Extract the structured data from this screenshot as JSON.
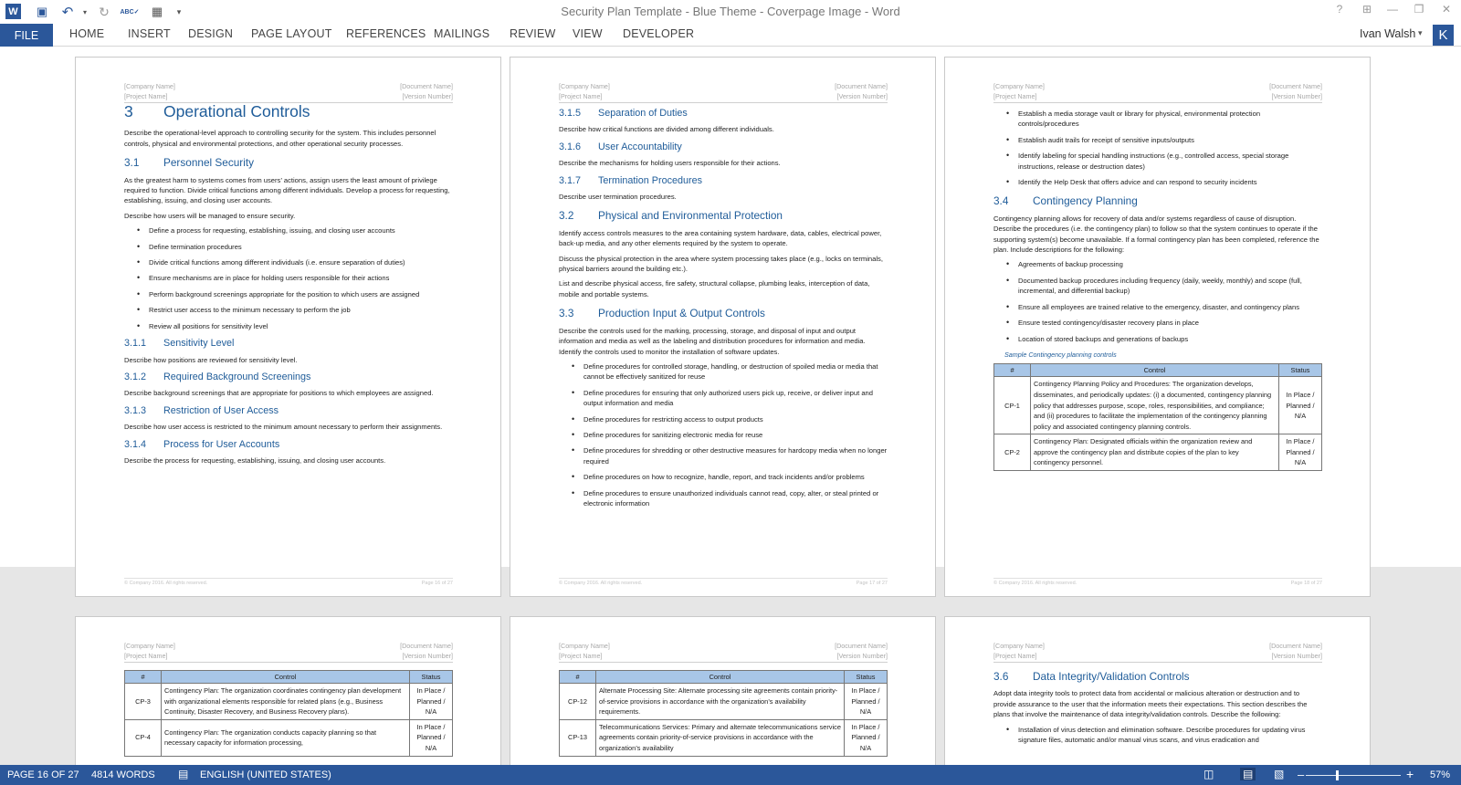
{
  "window": {
    "title": "Security Plan Template - Blue Theme - Coverpage Image - Word",
    "help_icon": "?",
    "ribbon_display_icon": "⊞",
    "minimize_icon": "—",
    "restore_icon": "❐",
    "close_icon": "✕"
  },
  "quick_access": {
    "word_icon": "W",
    "save_icon": "▣",
    "undo_icon": "↶",
    "redo_icon": "↻",
    "spelling_icon": "ABC✓",
    "touch_icon": "▦",
    "customize_icon": "▾"
  },
  "ribbon": {
    "file": "FILE",
    "tabs": [
      "HOME",
      "INSERT",
      "DESIGN",
      "PAGE LAYOUT",
      "REFERENCES",
      "MAILINGS",
      "REVIEW",
      "VIEW",
      "DEVELOPER"
    ],
    "user_name": "Ivan Walsh",
    "user_caret": "▾",
    "avatar_initial": "K"
  },
  "header": {
    "company": "[Company Name]",
    "project": "[Project Name]",
    "document": "[Document Name]",
    "version": "[Version Number]"
  },
  "footer": {
    "copyright": "© Company 2016. All rights reserved.",
    "page16": "Page 16 of 27",
    "page17": "Page 17 of 27",
    "page18": "Page 18 of 27"
  },
  "page16": {
    "h1_num": "3",
    "h1": "Operational Controls",
    "intro": "Describe the operational-level approach to controlling security for the system. This includes personnel controls, physical and environmental protections, and other operational security processes.",
    "s31_num": "3.1",
    "s31": "Personnel Security",
    "s31_p1": "As the greatest harm to systems comes from users’ actions, assign users the least amount of privilege required to function. Divide critical functions among different individuals. Develop a process for requesting, establishing, issuing, and closing user accounts.",
    "s31_p2": "Describe how users will be managed to ensure security.",
    "s31_bullets": [
      "Define a process for requesting, establishing, issuing, and closing user accounts",
      "Define termination procedures",
      "Divide critical functions among different individuals (i.e. ensure separation of duties)",
      "Ensure mechanisms are in place for holding users responsible for their actions",
      "Perform background screenings appropriate for the position to which users are assigned",
      "Restrict user access to the minimum necessary to perform the job",
      "Review all positions for sensitivity level"
    ],
    "s311_num": "3.1.1",
    "s311": "Sensitivity Level",
    "s311_p": "Describe how positions are reviewed for sensitivity level.",
    "s312_num": "3.1.2",
    "s312": "Required Background Screenings",
    "s312_p": "Describe background screenings that are appropriate for positions to which employees are assigned.",
    "s313_num": "3.1.3",
    "s313": "Restriction of User Access",
    "s313_p": "Describe how user access is restricted to the minimum amount necessary to perform their assignments.",
    "s314_num": "3.1.4",
    "s314": "Process for User Accounts",
    "s314_p": "Describe the process for requesting, establishing, issuing, and closing user accounts."
  },
  "page17": {
    "s315_num": "3.1.5",
    "s315": "Separation of Duties",
    "s315_p": "Describe how critical functions are divided among different individuals.",
    "s316_num": "3.1.6",
    "s316": "User Accountability",
    "s316_p": "Describe the mechanisms for holding users responsible for their actions.",
    "s317_num": "3.1.7",
    "s317": "Termination Procedures",
    "s317_p": "Describe user termination procedures.",
    "s32_num": "3.2",
    "s32": "Physical and Environmental Protection",
    "s32_p1": "Identify access controls measures to the area containing system hardware, data, cables, electrical power, back-up media, and any other elements required by the system to operate.",
    "s32_p2": "Discuss the physical protection in the area where system processing takes place (e.g., locks on terminals, physical barriers around the building etc.).",
    "s32_p3": "List and describe physical access, fire safety, structural collapse, plumbing leaks, interception of data, mobile and portable systems.",
    "s33_num": "3.3",
    "s33": "Production Input & Output Controls",
    "s33_p": "Describe the controls used for the marking, processing, storage, and disposal of input and output information and media as well as the labeling and distribution procedures for information and media. Identify the controls used to monitor the installation of software updates.",
    "s33_bullets": [
      "Define procedures for controlled storage, handling, or destruction of spoiled media or media that cannot be effectively sanitized for reuse",
      "Define procedures for ensuring that only authorized users pick up, receive, or deliver input and output information and media",
      "Define procedures for restricting access to output products",
      "Define procedures for sanitizing electronic media for reuse",
      "Define procedures for shredding or other destructive measures for hardcopy media when no longer required",
      "Define procedures on how to recognize, handle, report, and track incidents and/or problems",
      "Define procedures to ensure unauthorized individuals cannot read, copy, alter, or steal printed or electronic information"
    ]
  },
  "page18": {
    "bullets_top": [
      "Establish a media storage vault or library for physical, environmental protection controls/procedures",
      "Establish audit trails for receipt of sensitive inputs/outputs",
      "Identify labeling for special handling instructions (e.g., controlled access, special storage instructions, release or destruction dates)",
      "Identify the Help Desk that offers advice and can respond to security incidents"
    ],
    "s34_num": "3.4",
    "s34": "Contingency Planning",
    "s34_p": "Contingency planning allows for recovery of data and/or systems regardless of cause of disruption. Describe the procedures (i.e. the contingency plan) to follow so that the system continues to operate if the supporting system(s) become unavailable. If a formal contingency plan has been completed, reference the plan. Include descriptions for the following:",
    "s34_bullets": [
      "Agreements of backup processing",
      "Documented backup procedures including frequency (daily, weekly, monthly) and scope (full, incremental, and differential backup)",
      "Ensure all employees are trained relative to the emergency, disaster, and contingency plans",
      "Ensure tested contingency/disaster recovery plans in place",
      "Location of stored backups and generations of backups"
    ],
    "caption": "Sample Contingency planning controls"
  },
  "table": {
    "col_id": "#",
    "col_control": "Control",
    "col_status": "Status",
    "status": "In Place / Planned / N/A"
  },
  "table_cp_a": [
    {
      "id": "CP-1",
      "control": "Contingency Planning Policy and Procedures: The organization develops, disseminates, and periodically updates: (i) a documented, contingency planning policy that addresses purpose, scope, roles, responsibilities, and compliance; and (ii) procedures to facilitate the implementation of the contingency planning policy and associated contingency planning controls."
    },
    {
      "id": "CP-2",
      "control": "Contingency Plan:  Designated officials within the organization review and approve the contingency plan and distribute copies of the plan to key contingency personnel."
    }
  ],
  "table_cp_b": [
    {
      "id": "CP-3",
      "control": "Contingency Plan:  The organization coordinates contingency plan development with organizational elements responsible for related plans (e.g., Business Continuity, Disaster Recovery, and Business Recovery plans)."
    },
    {
      "id": "CP-4",
      "control": "Contingency Plan:  The organization conducts capacity planning so that necessary capacity for information processing,"
    }
  ],
  "table_cp_c": [
    {
      "id": "CP-12",
      "control": "Alternate Processing Site:  Alternate processing site agreements contain priority-of-service provisions in accordance with the organization’s availability requirements."
    },
    {
      "id": "CP-13",
      "control": "Telecommunications Services:  Primary and alternate telecommunications service agreements contain priority-of-service provisions in accordance with the organization’s availability"
    }
  ],
  "page21": {
    "s36_num": "3.6",
    "s36": "Data Integrity/Validation Controls",
    "s36_p": "Adopt data integrity tools to protect data from accidental or malicious alteration or destruction and to provide assurance to the user that the information meets their expectations. This section describes the plans that involve the maintenance of data integrity/validation controls. Describe the following:",
    "s36_bullets": [
      "Installation of virus detection and elimination software. Describe procedures for updating virus signature files, automatic and/or manual virus scans, and virus eradication and"
    ]
  },
  "statusbar": {
    "page": "PAGE 16 OF 27",
    "words": "4814 WORDS",
    "proofing_icon": "▤",
    "language": "ENGLISH (UNITED STATES)",
    "read_mode_icon": "◫",
    "print_layout_icon": "▤",
    "web_layout_icon": "▧",
    "zoom_out": "–",
    "zoom_in": "+",
    "zoom": "57%",
    "zoom_level": 0.57
  }
}
